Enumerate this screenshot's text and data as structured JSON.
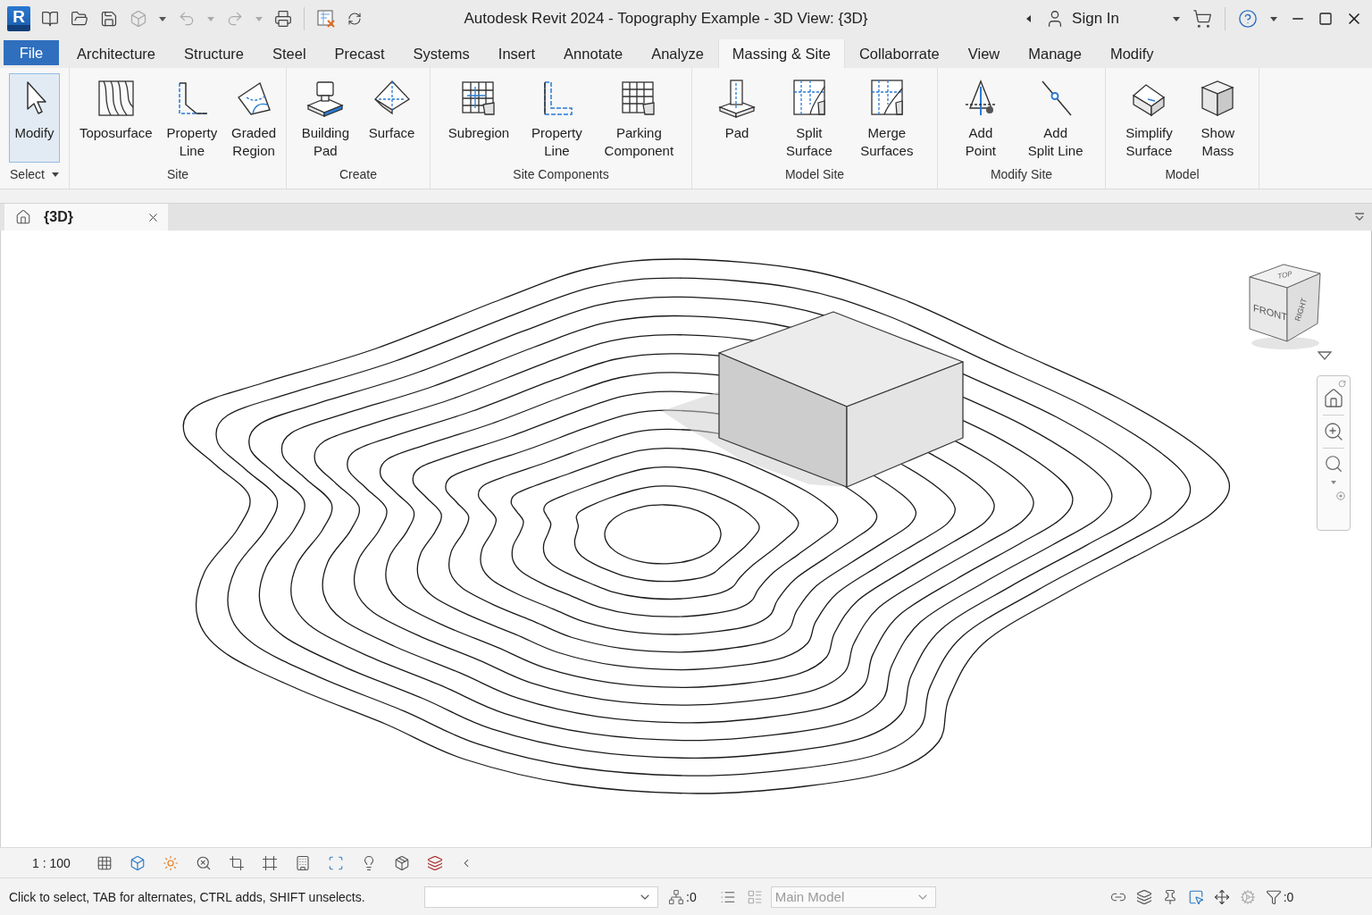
{
  "window": {
    "app_logo": "R",
    "title": "Autodesk Revit 2024 - Topography Example - 3D View: {3D}"
  },
  "account": {
    "label": "Sign In"
  },
  "ribbon_tabs": [
    {
      "label": "File",
      "kind": "file",
      "selected": false
    },
    {
      "label": "Architecture",
      "kind": "tab",
      "selected": false
    },
    {
      "label": "Structure",
      "kind": "tab",
      "selected": false
    },
    {
      "label": "Steel",
      "kind": "tab",
      "selected": false
    },
    {
      "label": "Precast",
      "kind": "tab",
      "selected": false
    },
    {
      "label": "Systems",
      "kind": "tab",
      "selected": false
    },
    {
      "label": "Insert",
      "kind": "tab",
      "selected": false
    },
    {
      "label": "Annotate",
      "kind": "tab",
      "selected": false
    },
    {
      "label": "Analyze",
      "kind": "tab",
      "selected": false
    },
    {
      "label": "Massing & Site",
      "kind": "tab",
      "selected": true
    },
    {
      "label": "Collaborrate",
      "kind": "tab",
      "selected": false
    },
    {
      "label": "View",
      "kind": "tab",
      "selected": false
    },
    {
      "label": "Manage",
      "kind": "tab",
      "selected": false
    },
    {
      "label": "Modify",
      "kind": "tab",
      "selected": false
    }
  ],
  "ribbon_panels": [
    {
      "title": "Select",
      "dropdown": true,
      "tools": [
        {
          "label": [
            "Modify"
          ],
          "selected": true
        }
      ]
    },
    {
      "title": "Site",
      "dropdown": false,
      "tools": [
        {
          "label": [
            "Toposurface"
          ],
          "selected": false
        },
        {
          "label": [
            "Property",
            "Line"
          ],
          "selected": false
        },
        {
          "label": [
            "Graded",
            "Region"
          ],
          "selected": false
        }
      ]
    },
    {
      "title": "Create",
      "dropdown": false,
      "tools": [
        {
          "label": [
            "Building",
            "Pad"
          ],
          "selected": false
        },
        {
          "label": [
            "Surface"
          ],
          "selected": false
        }
      ]
    },
    {
      "title": "Site Components",
      "dropdown": false,
      "tools": [
        {
          "label": [
            "Subregion"
          ],
          "selected": false
        },
        {
          "label": [
            "Property",
            "Line"
          ],
          "selected": false
        },
        {
          "label": [
            "Parking",
            "Component"
          ],
          "selected": false
        }
      ]
    },
    {
      "title": "Model Site",
      "dropdown": false,
      "tools": [
        {
          "label": [
            "Pad"
          ],
          "selected": false
        },
        {
          "label": [
            "Split",
            "Surface"
          ],
          "selected": false
        },
        {
          "label": [
            "Merge",
            "Surfaces"
          ],
          "selected": false
        }
      ]
    },
    {
      "title": "Modify Site",
      "dropdown": false,
      "tools": [
        {
          "label": [
            "Add",
            "Point"
          ],
          "selected": false
        },
        {
          "label": [
            "Add",
            "Split Line"
          ],
          "selected": false
        }
      ]
    },
    {
      "title": "Model",
      "dropdown": false,
      "tools": [
        {
          "label": [
            "Simplify",
            "Surface"
          ],
          "selected": false
        },
        {
          "label": [
            "Show",
            "Mass"
          ],
          "selected": false
        }
      ]
    }
  ],
  "view_tabs": [
    {
      "label": "{3D}",
      "selected": true
    }
  ],
  "viewcube": {
    "top": "TOP",
    "front": "FRONT",
    "right": "RIGHT"
  },
  "view_control_bar": {
    "scale": "1 : 100"
  },
  "status_bar": {
    "message": "Click to select, TAB for alternates, CTRL adds, SHIFT unselects.",
    "selection_count": ":0",
    "design_option": {
      "value": "Main Model",
      "disabled": true
    },
    "filter_count": ":0"
  }
}
